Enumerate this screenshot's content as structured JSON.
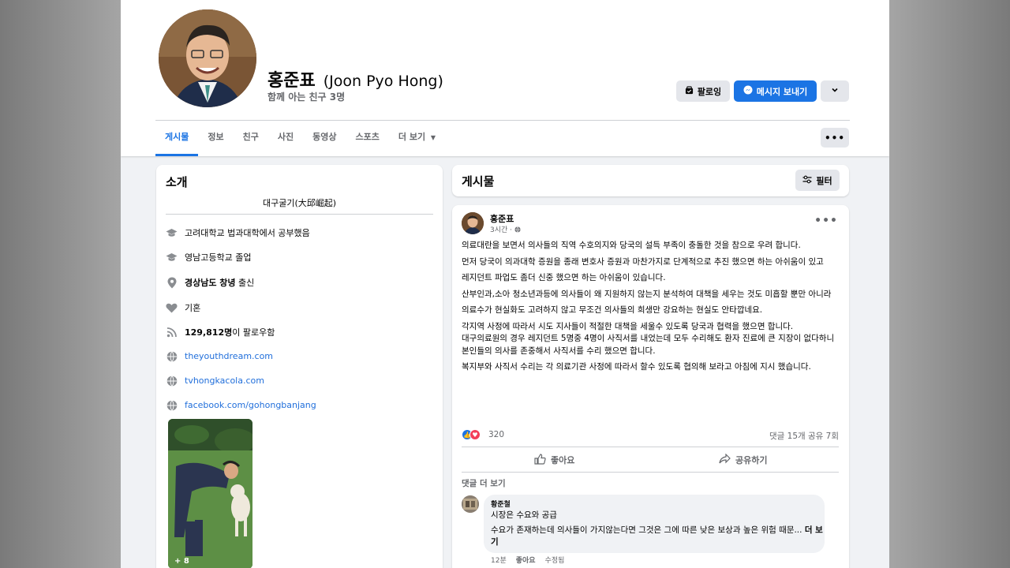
{
  "profile": {
    "name": "홍준표",
    "name_en": "(Joon Pyo Hong)",
    "mutual_friends": "함께 아는 친구 3명"
  },
  "actions": {
    "following": "팔로잉",
    "message": "메시지 보내기"
  },
  "tabs": [
    "게시물",
    "정보",
    "친구",
    "사진",
    "동영상",
    "스포츠",
    "더 보기"
  ],
  "intro": {
    "title": "소개",
    "bio": "대구굴기(大邱崛起)",
    "items": [
      {
        "icon": "graduation-cap-icon",
        "text": "고려대학교 법과대학에서 공부했음"
      },
      {
        "icon": "graduation-cap-icon",
        "text": "영남고등학교 졸업"
      },
      {
        "icon": "location-pin-icon",
        "bold": "경상남도 창녕",
        "text": " 출신"
      },
      {
        "icon": "heart-icon",
        "text": "기혼"
      },
      {
        "icon": "rss-icon",
        "bold": "129,812명",
        "text": "이 팔로우함"
      },
      {
        "icon": "globe-icon",
        "text": "theyouthdream.com"
      },
      {
        "icon": "globe-icon",
        "text": "tvhongkacola.com"
      },
      {
        "icon": "globe-icon",
        "text": "facebook.com/gohongbanjang"
      }
    ],
    "photo_count": "+ 8"
  },
  "posts_header": {
    "title": "게시물",
    "filter": "필터"
  },
  "post": {
    "author": "홍준표",
    "time": "3시간 ·",
    "paragraphs": [
      "의료대란을 보면서 의사들의 직역 수호의지와 당국의 설득 부족이 충돌한 것을 참으로 우려 합니다.",
      "먼저 당국이 의과대학 증원을 종래 변호사 증원과 마찬가지로  단계적으로 추진 했으면 하는 아쉬움이 있고",
      "레지던트 파업도 좀더 신중 했으면 하는 아쉬움이 있습니다.",
      "산부인과,소아 청소년과등에 의사들이 왜 지원하지 않는지 분석하여 대책을 세우는 것도 미흡할 뿐만 아니라",
      "의료수가 현실화도 고려하지 않고 무조건 의사들의 희생만 강요하는 현실도 안타깝네요.",
      "각지역 사정에 따라서 시도 지사들이 적절한 대책을 세울수 있도록 당국과 협력을 했으면 합니다.",
      "대구의료원의 경우 레지던트 5명중 4명이 사직서를 내었는데 모두 수리해도 환자 진료에 큰 지장이 없다하니 본인들의 의사를 존중해서 사직서를 수리 했으면 합니다.",
      "복지부와 사직서 수리는 각 의료기관 사정에 따라서 할수 있도록 협의해 보라고 아침에 지시 했습니다."
    ],
    "reactions": "320",
    "comments_shares": "댓글 15개   공유 7회",
    "like": "좋아요",
    "share": "공유하기",
    "more_comments": "댓글 더 보기",
    "comment": {
      "author": "황준철",
      "line1": "시장은 수요와 공급",
      "line2": "수요가 존재하는데 의사들이 가지않는다면 그것은 그에 따른 낮은 보상과 높은 위험 때문...",
      "see_more": "더 보기",
      "time": "12분",
      "like": "좋아요",
      "edited": "수정됨"
    }
  },
  "colors": {
    "accent": "#1b74e4",
    "page_bg": "#f0f2f5",
    "secondary_text": "#65676b",
    "link": "#216fdb"
  }
}
